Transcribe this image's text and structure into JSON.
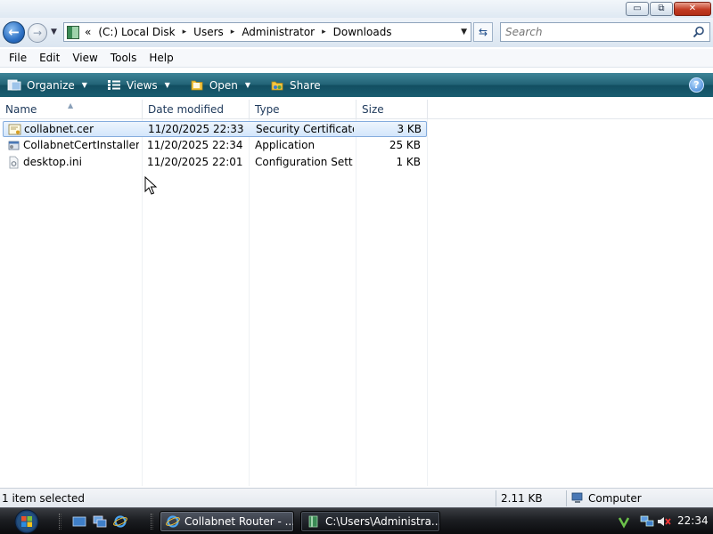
{
  "window": {
    "controls": {
      "minimize": "▭",
      "maximize": "⧉",
      "close": "✕"
    }
  },
  "address": {
    "overflow": "«",
    "segments": [
      "(C:) Local Disk",
      "Users",
      "Administrator",
      "Downloads"
    ],
    "separator": "▸"
  },
  "search": {
    "placeholder": "Search"
  },
  "menu": {
    "file": "File",
    "edit": "Edit",
    "view": "View",
    "tools": "Tools",
    "help": "Help"
  },
  "toolbar": {
    "organize": "Organize",
    "views": "Views",
    "open": "Open",
    "share": "Share",
    "help": "?"
  },
  "columns": {
    "name": "Name",
    "date": "Date modified",
    "type": "Type",
    "size": "Size"
  },
  "files": [
    {
      "name": "collabnet.cer",
      "date": "11/20/2025 22:33",
      "type": "Security Certificate",
      "size": "3 KB",
      "selected": true,
      "icon": "certificate-icon"
    },
    {
      "name": "CollabnetCertInstaller....",
      "date": "11/20/2025 22:34",
      "type": "Application",
      "size": "25 KB",
      "selected": false,
      "icon": "application-icon"
    },
    {
      "name": "desktop.ini",
      "date": "11/20/2025 22:01",
      "type": "Configuration Sett...",
      "size": "1 KB",
      "selected": false,
      "icon": "config-file-icon"
    }
  ],
  "status": {
    "selection": "1 item selected",
    "size": "2.11 KB",
    "location": "Computer"
  },
  "taskbar": {
    "tasks": [
      {
        "label": "Collabnet Router - ...",
        "active": false,
        "icon": "internet-explorer-icon"
      },
      {
        "label": "C:\\Users\\Administra...",
        "active": true,
        "icon": "folder-window-icon"
      }
    ],
    "clock": "22:34"
  },
  "colors": {
    "command_bar": "#1b5e70",
    "selection_border": "#84acdd",
    "taskbar": "#1c1e22"
  }
}
